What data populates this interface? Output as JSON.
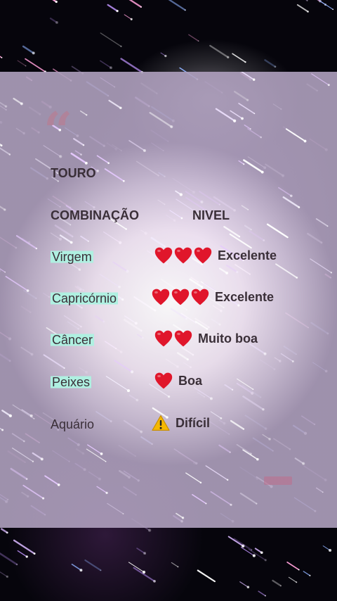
{
  "heading": {
    "sign": "TOURO"
  },
  "columns": {
    "combination": "COMBINAÇÃO",
    "level": "NIVEL"
  },
  "quote_mark": "“",
  "rows": [
    {
      "sign": "Virgem",
      "hearts": 3,
      "level": "Excelente",
      "icon": "heart-icon"
    },
    {
      "sign": "Capricórnio",
      "hearts": 3,
      "level": "Excelente",
      "icon": "heart-icon"
    },
    {
      "sign": "Câncer",
      "hearts": 2,
      "level": "Muito boa",
      "icon": "heart-icon"
    },
    {
      "sign": "Peixes",
      "hearts": 1,
      "level": "Boa",
      "icon": "heart-icon"
    },
    {
      "sign": "Aquário",
      "hearts": 0,
      "level": "Difícil",
      "icon": "warning-icon"
    }
  ],
  "colors": {
    "heart": "#e0162b",
    "highlight": "#aff0e1",
    "warning": "#f5b800",
    "text": "#3a2f38"
  }
}
